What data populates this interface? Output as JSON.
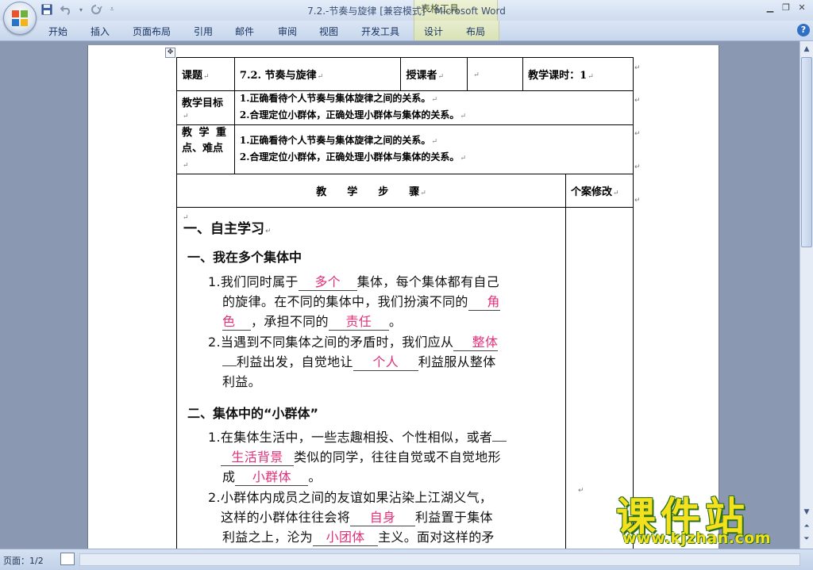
{
  "window": {
    "doc_title": "7.2.-节奏与旋律 [兼容模式]",
    "separator": " - ",
    "app_name": "Microsoft Word",
    "context_tools_label": "表格工具"
  },
  "ribbon": {
    "tabs": [
      "开始",
      "插入",
      "页面布局",
      "引用",
      "邮件",
      "审阅",
      "视图",
      "开发工具"
    ],
    "context_tabs": [
      "设计",
      "布局"
    ]
  },
  "table": {
    "topic_label": "课题",
    "topic_value": "7.2. 节奏与旋律",
    "teacher_label": "授课者",
    "teacher_value": "",
    "hours_label": "教学课时：1",
    "goal_label": "教学目标",
    "goal_lines": [
      "1.正确看待个人节奏与集体旋律之间的关系。",
      "2.合理定位小群体，正确处理小群体与集体的关系。"
    ],
    "key_label_line1": "教 学 重",
    "key_label_line2": "点、难点",
    "key_lines": [
      "1.正确看待个人节奏与集体旋律之间的关系。",
      "2.合理定位小群体，正确处理小群体与集体的关系。"
    ],
    "steps_header": "教　　学　　步　　骤",
    "revise_header": "个案修改"
  },
  "content": {
    "section1_title": "一、自主学习",
    "sub1_title": "一、我在多个集体中",
    "q1_a": "1.我们同时属于",
    "q1_blank1": "多个",
    "q1_b": "集体，每个集体都有自己",
    "q1_c": "的旋律。在不同的集体中，我们扮演不同的",
    "q1_blank2a": "角",
    "q1_blank2b": "色",
    "q1_d": "，承担不同的",
    "q1_blank3": "责任",
    "q1_e": "。",
    "q2_a": "2.当遇到不同集体之间的矛盾时，我们应从",
    "q2_blank1": "整体",
    "q2_b": "利益出发，自觉地让",
    "q2_blank2": "个人",
    "q2_c": "利益服从整体",
    "q2_d": "利益。",
    "sub2_title": "二、集体中的“小群体”",
    "q3_a": "1.在集体生活中，一些志趣相投、个性相似，或者",
    "q3_blank1": "生活背景",
    "q3_b": "类似的同学，往往自觉或不自觉地形",
    "q3_c": "成",
    "q3_blank2": "小群体",
    "q3_d": "。",
    "q4_a": "2.小群体内成员之间的友谊如果沾染上江湖义气，",
    "q4_b": "这样的小群体往往会将",
    "q4_blank1": "自身",
    "q4_c": "利益置于集体",
    "q4_d": "利益之上，沦为",
    "q4_blank2": "小团体",
    "q4_e": "主义。面对这样的矛"
  },
  "status": {
    "page": "页面：1/2"
  },
  "watermark": {
    "cn": "课件站",
    "url": "www.kjzhan.com"
  },
  "colors": {
    "answer": "#e0307a",
    "ribbon": "#c7d6ec",
    "doc_bg": "#8a98b1"
  }
}
